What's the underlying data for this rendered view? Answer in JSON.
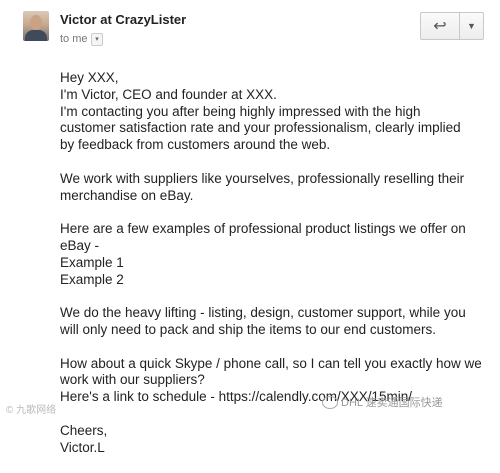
{
  "header": {
    "sender": "Victor at CrazyLister",
    "recipient": "to me",
    "reply_icon": "reply-icon",
    "more_icon": "caret-down-icon"
  },
  "body": {
    "greeting": "Hey XXX,",
    "p1": [
      "I'm Victor, CEO and founder at XXX.",
      "I'm contacting you after being highly impressed with the high",
      "customer satisfaction rate and your professionalism, clearly implied",
      "by feedback from customers around the web."
    ],
    "p2": [
      "We work with suppliers like yourselves, professionally reselling their",
      "merchandise on eBay."
    ],
    "p3": [
      "Here are a few examples of professional product listings we offer on",
      "eBay -",
      "Example 1",
      "Example 2"
    ],
    "p4": [
      "We do the heavy lifting - listing, design, customer support, while you",
      "will only need to pack and ship the items to our end customers."
    ],
    "p5": [
      "How about a quick Skype / phone call, so I can tell you exactly how we",
      "work with our suppliers?",
      "Here's a link to schedule - https://calendly.com/XXX/15min/"
    ],
    "closing": "Cheers,",
    "signature": "Victor.L"
  },
  "watermarks": {
    "left": "© 九歌网络",
    "right": "DHL 速卖通国际快递"
  }
}
